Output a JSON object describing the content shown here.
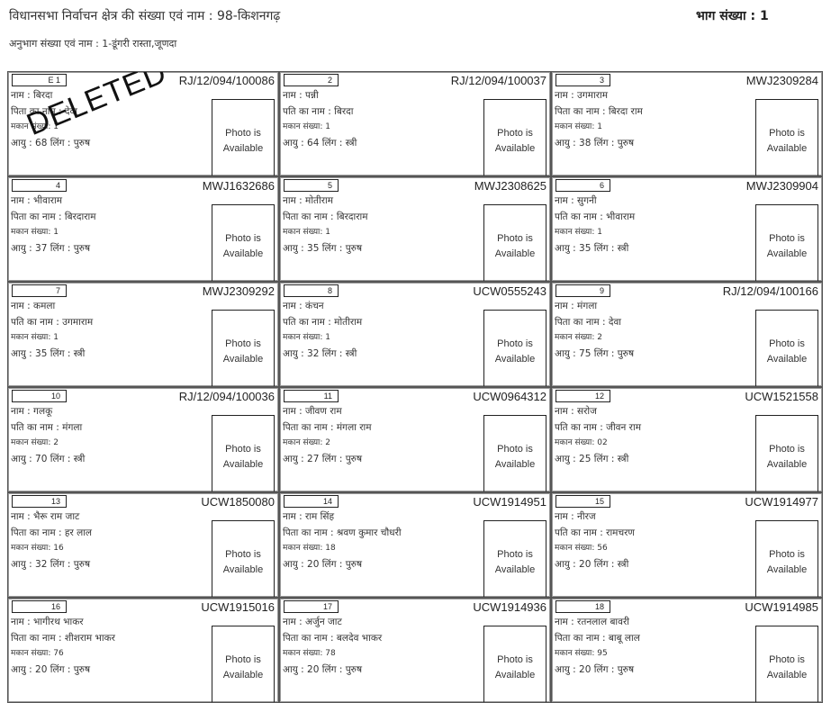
{
  "header": {
    "constituency": "विधानसभा निर्वाचन क्षेत्र की संख्या एवं नाम  : 98-किशनगढ़",
    "part_number": "भाग संख्या : 1",
    "section": "अनुभाग संख्या एवं नाम : 1-डूंगरी रास्ता,जूणदा"
  },
  "photo_text": {
    "line1": "Photo is",
    "line2": "Available"
  },
  "deleted_stamp": "DELETED",
  "voters": [
    {
      "serial": "E 1",
      "epic": "RJ/12/094/100086",
      "name": "नाम : बिरदा",
      "relation": "पिता का नाम : देवा",
      "house": "मकान संख्या: 1",
      "age_gender": "आयु : 68  लिंग : पुरुष",
      "deleted": true
    },
    {
      "serial": "2",
      "epic": "RJ/12/094/100037",
      "name": "नाम : पन्नी",
      "relation": "पति का नाम : बिरदा",
      "house": "मकान संख्या: 1",
      "age_gender": "आयु : 64  लिंग : स्त्री"
    },
    {
      "serial": "3",
      "epic": "MWJ2309284",
      "name": "नाम : उगमाराम",
      "relation": "पिता का नाम : बिरदा राम",
      "house": "मकान संख्या: 1",
      "age_gender": "आयु : 38  लिंग : पुरुष"
    },
    {
      "serial": "4",
      "epic": "MWJ1632686",
      "name": "नाम : भीवाराम",
      "relation": "पिता का नाम : बिरदाराम",
      "house": "मकान संख्या: 1",
      "age_gender": "आयु : 37  लिंग : पुरुष"
    },
    {
      "serial": "5",
      "epic": "MWJ2308625",
      "name": "नाम : मोतीराम",
      "relation": "पिता का नाम : बिरदाराम",
      "house": "मकान संख्या: 1",
      "age_gender": "आयु : 35  लिंग : पुरुष"
    },
    {
      "serial": "6",
      "epic": "MWJ2309904",
      "name": "नाम : सुगनी",
      "relation": "पति का नाम : भीवाराम",
      "house": "मकान संख्या: 1",
      "age_gender": "आयु : 35  लिंग : स्त्री"
    },
    {
      "serial": "7",
      "epic": "MWJ2309292",
      "name": "नाम : कमला",
      "relation": "पति का नाम : उगमाराम",
      "house": "मकान संख्या: 1",
      "age_gender": "आयु : 35  लिंग : स्त्री"
    },
    {
      "serial": "8",
      "epic": "UCW0555243",
      "name": "नाम : कंचन",
      "relation": "पति का नाम : मोतीराम",
      "house": "मकान संख्या: 1",
      "age_gender": "आयु : 32  लिंग : स्त्री"
    },
    {
      "serial": "9",
      "epic": "RJ/12/094/100166",
      "name": "नाम : मंगला",
      "relation": "पिता का नाम : देवा",
      "house": "मकान संख्या: 2",
      "age_gender": "आयु : 75  लिंग : पुरुष"
    },
    {
      "serial": "10",
      "epic": "RJ/12/094/100036",
      "name": "नाम : गलकू",
      "relation": "पति का नाम : मंगला",
      "house": "मकान संख्या: 2",
      "age_gender": "आयु : 70  लिंग : स्त्री"
    },
    {
      "serial": "11",
      "epic": "UCW0964312",
      "name": "नाम : जीवण राम",
      "relation": "पिता का नाम : मंगला राम",
      "house": "मकान संख्या: 2",
      "age_gender": "आयु : 27  लिंग : पुरुष"
    },
    {
      "serial": "12",
      "epic": "UCW1521558",
      "name": "नाम : सरोज",
      "relation": "पति का नाम : जीवन राम",
      "house": "मकान संख्या: 02",
      "age_gender": "आयु : 25  लिंग : स्त्री"
    },
    {
      "serial": "13",
      "epic": "UCW1850080",
      "name": "नाम : भैरू राम जाट",
      "relation": "पिता का नाम : हर लाल",
      "house": "मकान संख्या: 16",
      "age_gender": "आयु : 32  लिंग : पुरुष"
    },
    {
      "serial": "14",
      "epic": "UCW1914951",
      "name": "नाम : राम सिंह",
      "relation": "पिता का नाम : श्रवण कुमार चौधरी",
      "house": "मकान संख्या: 18",
      "age_gender": "आयु : 20  लिंग : पुरुष"
    },
    {
      "serial": "15",
      "epic": "UCW1914977",
      "name": "नाम : नीरज",
      "relation": "पति का नाम : रामचरण",
      "house": "मकान संख्या: 56",
      "age_gender": "आयु : 20  लिंग : स्त्री"
    },
    {
      "serial": "16",
      "epic": "UCW1915016",
      "name": "नाम : भागीरथ भाकर",
      "relation": "पिता का नाम : शीशराम भाकर",
      "house": "मकान संख्या: 76",
      "age_gender": "आयु : 20  लिंग : पुरुष"
    },
    {
      "serial": "17",
      "epic": "UCW1914936",
      "name": "नाम : अर्जुन जाट",
      "relation": "पिता का नाम : बलदेव भाकर",
      "house": "मकान संख्या: 78",
      "age_gender": "आयु : 20  लिंग : पुरुष"
    },
    {
      "serial": "18",
      "epic": "UCW1914985",
      "name": "नाम : रतनलाल बावरी",
      "relation": "पिता का नाम : बाबू लाल",
      "house": "मकान संख्या: 95",
      "age_gender": "आयु : 20  लिंग : पुरुष"
    }
  ]
}
